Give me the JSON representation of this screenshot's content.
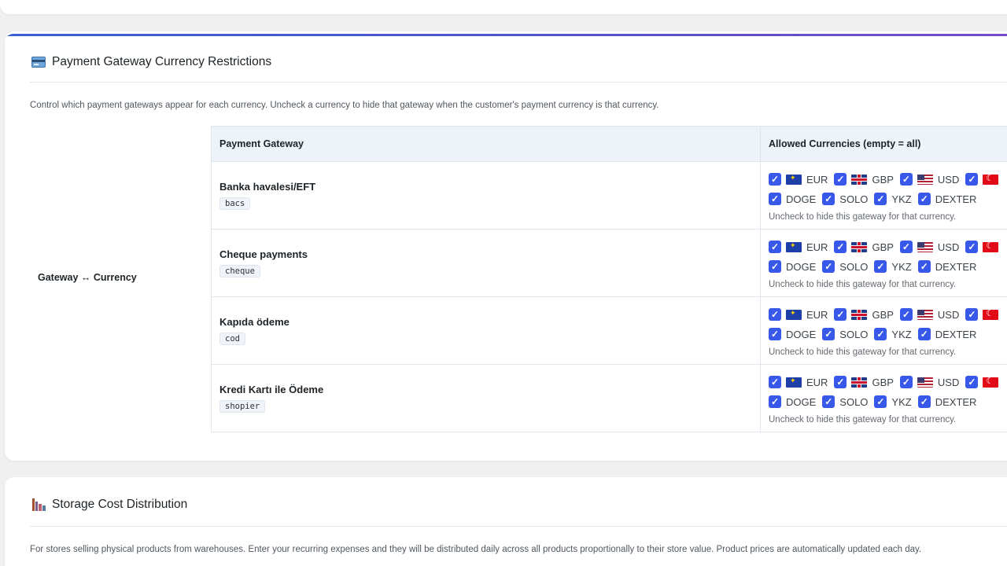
{
  "restrictions": {
    "title": "Payment Gateway Currency Restrictions",
    "icon": "credit-card-icon",
    "description": "Control which payment gateways appear for each currency. Uncheck a currency to hide that gateway when the customer's payment currency is that currency.",
    "row_label": "Gateway ↔ Currency",
    "headers": {
      "gateway": "Payment Gateway",
      "currencies": "Allowed Currencies (empty = all)"
    },
    "hint": "Uncheck to hide this gateway for that currency.",
    "currencies_line1": [
      {
        "code": "EUR",
        "flag": "eu-flag-icon",
        "checked": true
      },
      {
        "code": "GBP",
        "flag": "gb-flag-icon",
        "checked": true
      },
      {
        "code": "USD",
        "flag": "us-flag-icon",
        "checked": true
      },
      {
        "code": "",
        "flag": "tr-flag-icon",
        "checked": true
      }
    ],
    "currencies_line2": [
      {
        "code": "DOGE",
        "checked": true
      },
      {
        "code": "SOLO",
        "checked": true
      },
      {
        "code": "YKZ",
        "checked": true
      },
      {
        "code": "DEXTER",
        "checked": true
      }
    ],
    "gateways": [
      {
        "name": "Banka havalesi/EFT",
        "code": "bacs"
      },
      {
        "name": "Cheque payments",
        "code": "cheque"
      },
      {
        "name": "Kapıda ödeme",
        "code": "cod"
      },
      {
        "name": "Kredi Kartı ile Ödeme",
        "code": "shopier"
      }
    ]
  },
  "storage": {
    "title": "Storage Cost Distribution",
    "icon": "factory-icon",
    "description": "For stores selling physical products from warehouses. Enter your recurring expenses and they will be distributed daily across all products proportionally to their store value. Product prices are automatically updated each day."
  },
  "colors": {
    "accent": "#3858e9",
    "header_bg": "#eef3fa"
  }
}
